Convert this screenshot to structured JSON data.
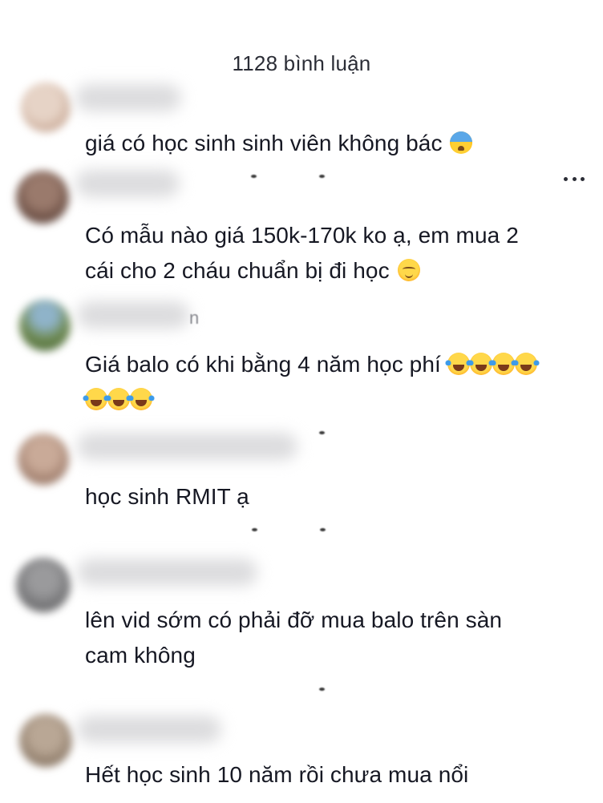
{
  "header": {
    "title": "1128 bình luận"
  },
  "comments": [
    {
      "avatar_color": "#d8bfae",
      "text": "giá có học sinh sinh viên không bác",
      "emoji": [
        "anxious-face-with-sweat"
      ]
    },
    {
      "avatar_color": "#7d5d50",
      "text_line1": "Có mẫu nào giá 150k-170k ko ạ, em mua 2",
      "text_line2": "cái cho 2 cháu chuẩn bị đi học",
      "emoji": [
        "relieved-face"
      ]
    },
    {
      "avatar_color": "#6f8a52",
      "username_tail": "n",
      "text_line1": "Giá balo có khi bằng 4 năm học phí",
      "emoji_line1": [
        "face-with-tears-of-joy",
        "face-with-tears-of-joy",
        "face-with-tears-of-joy",
        "face-with-tears-of-joy"
      ],
      "emoji_line2": [
        "face-with-tears-of-joy",
        "face-with-tears-of-joy",
        "face-with-tears-of-joy"
      ]
    },
    {
      "avatar_color": "#b08f7e",
      "text": "học sinh RMIT ạ"
    },
    {
      "avatar_color": "#7a7a7c",
      "text_line1": "lên vid sớm có phải đỡ mua balo trên sàn",
      "text_line2": "cam không"
    },
    {
      "avatar_color": "#9b8572",
      "text": "Hết học sinh 10 năm rồi chưa mua nổi"
    }
  ],
  "colors": {
    "text": "#161823",
    "header": "#2b2d36",
    "background": "#ffffff"
  },
  "icons": {
    "more": "more-horizontal-icon"
  }
}
